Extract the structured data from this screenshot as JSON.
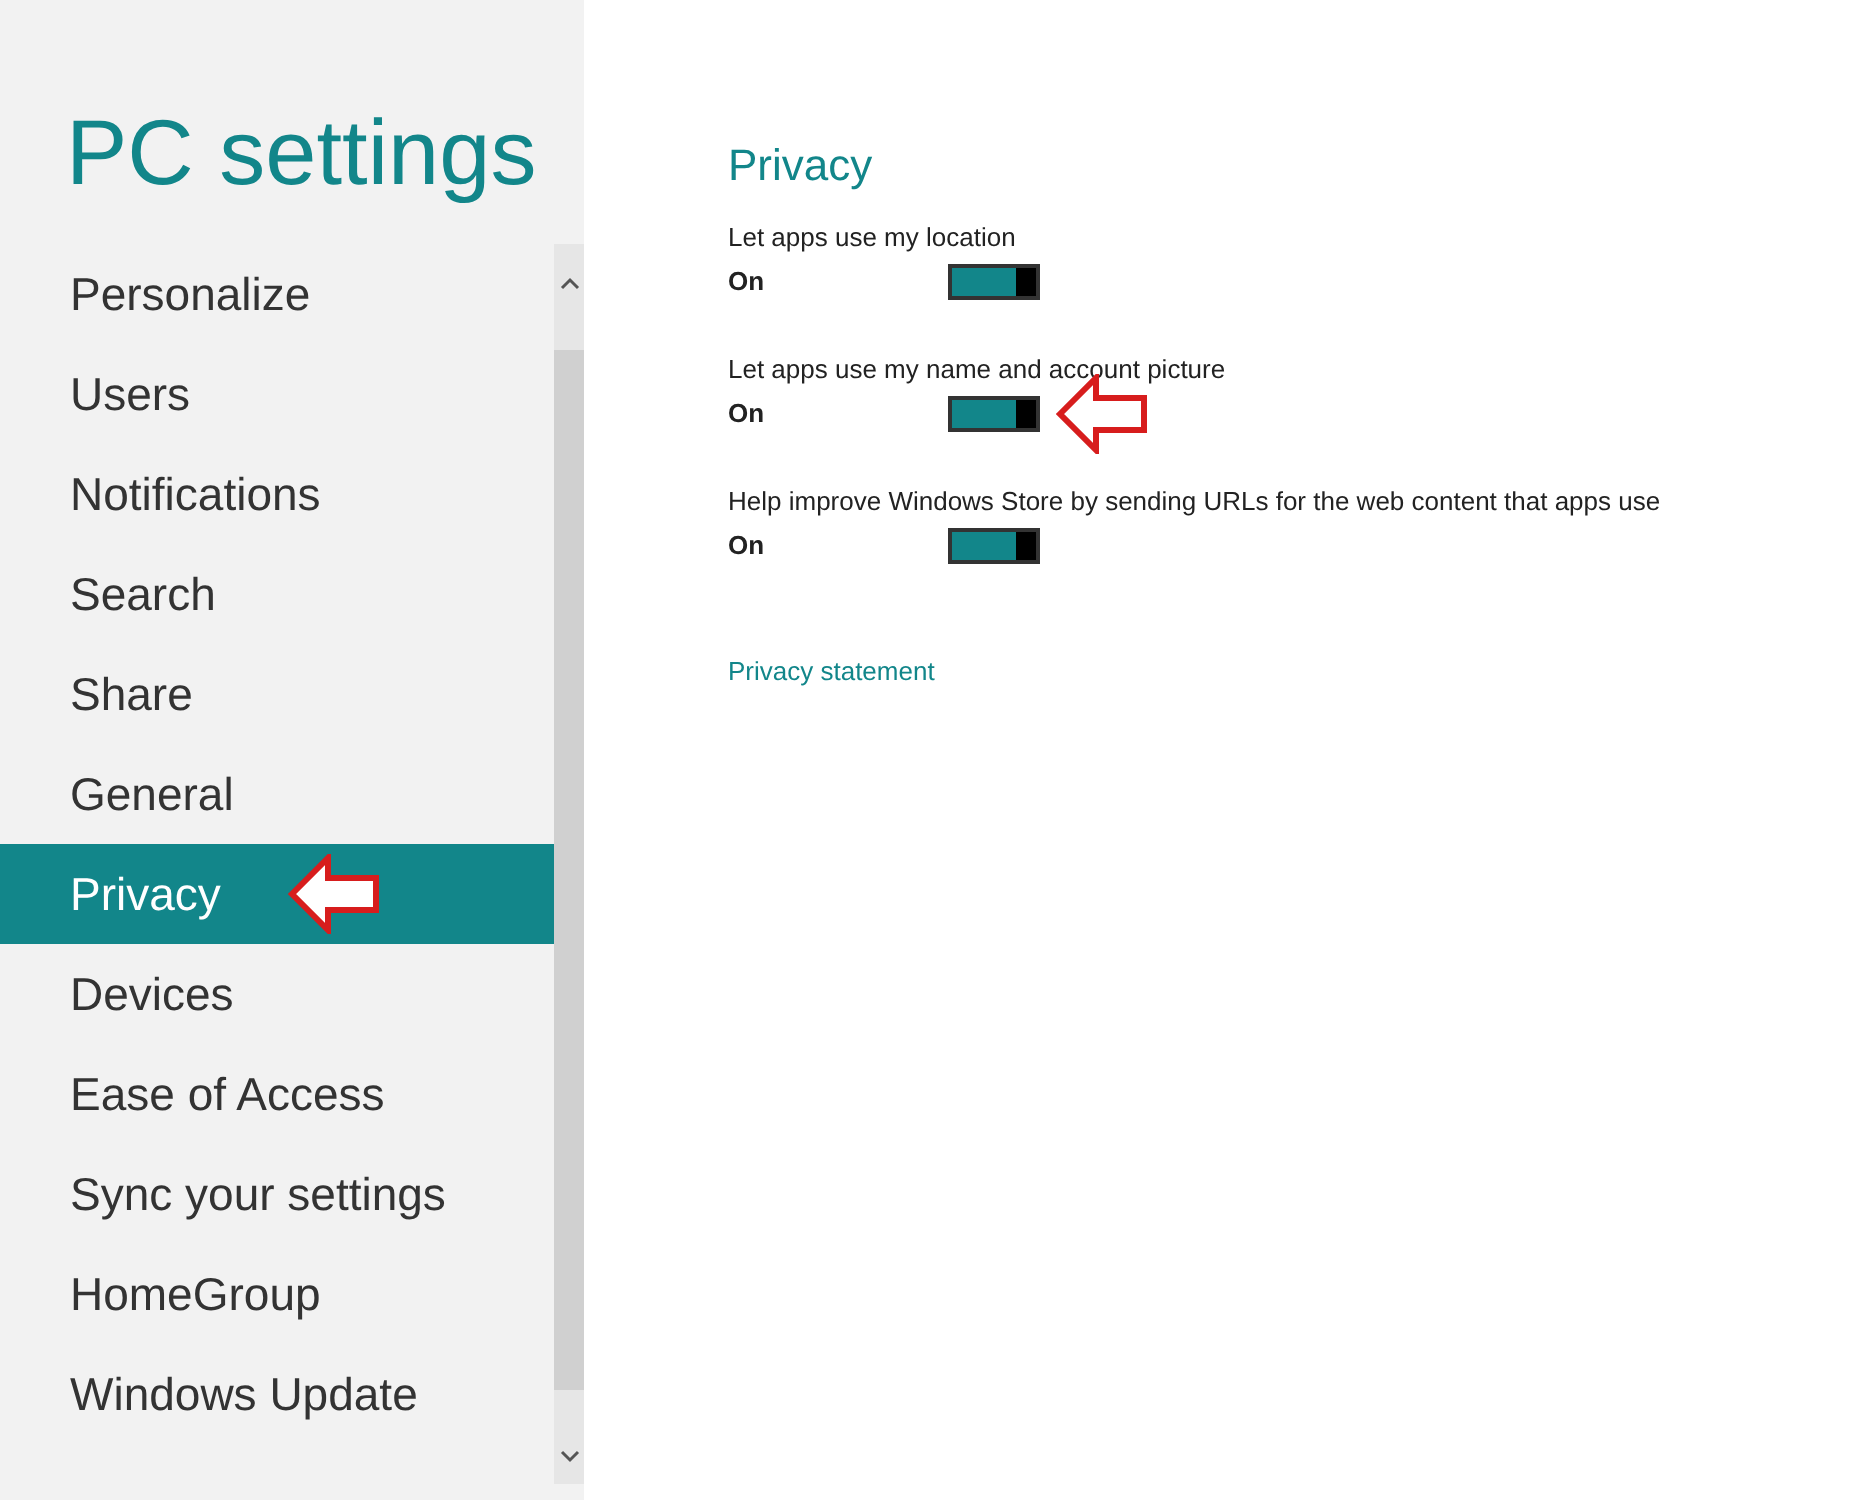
{
  "sidebar": {
    "title": "PC settings",
    "items": [
      {
        "label": "Personalize",
        "selected": false,
        "callout": false
      },
      {
        "label": "Users",
        "selected": false,
        "callout": false
      },
      {
        "label": "Notifications",
        "selected": false,
        "callout": false
      },
      {
        "label": "Search",
        "selected": false,
        "callout": false
      },
      {
        "label": "Share",
        "selected": false,
        "callout": false
      },
      {
        "label": "General",
        "selected": false,
        "callout": false
      },
      {
        "label": "Privacy",
        "selected": true,
        "callout": true
      },
      {
        "label": "Devices",
        "selected": false,
        "callout": false
      },
      {
        "label": "Ease of Access",
        "selected": false,
        "callout": false
      },
      {
        "label": "Sync your settings",
        "selected": false,
        "callout": false
      },
      {
        "label": "HomeGroup",
        "selected": false,
        "callout": false
      },
      {
        "label": "Windows Update",
        "selected": false,
        "callout": false
      }
    ]
  },
  "content": {
    "heading": "Privacy",
    "settings": [
      {
        "label": "Let apps use my location",
        "state": "On",
        "on": true,
        "callout": false
      },
      {
        "label": "Let apps use my name and account picture",
        "state": "On",
        "on": true,
        "callout": true
      },
      {
        "label": "Help improve Windows Store by sending URLs for the web content that apps use",
        "state": "On",
        "on": true,
        "callout": false
      }
    ],
    "link": "Privacy statement"
  }
}
